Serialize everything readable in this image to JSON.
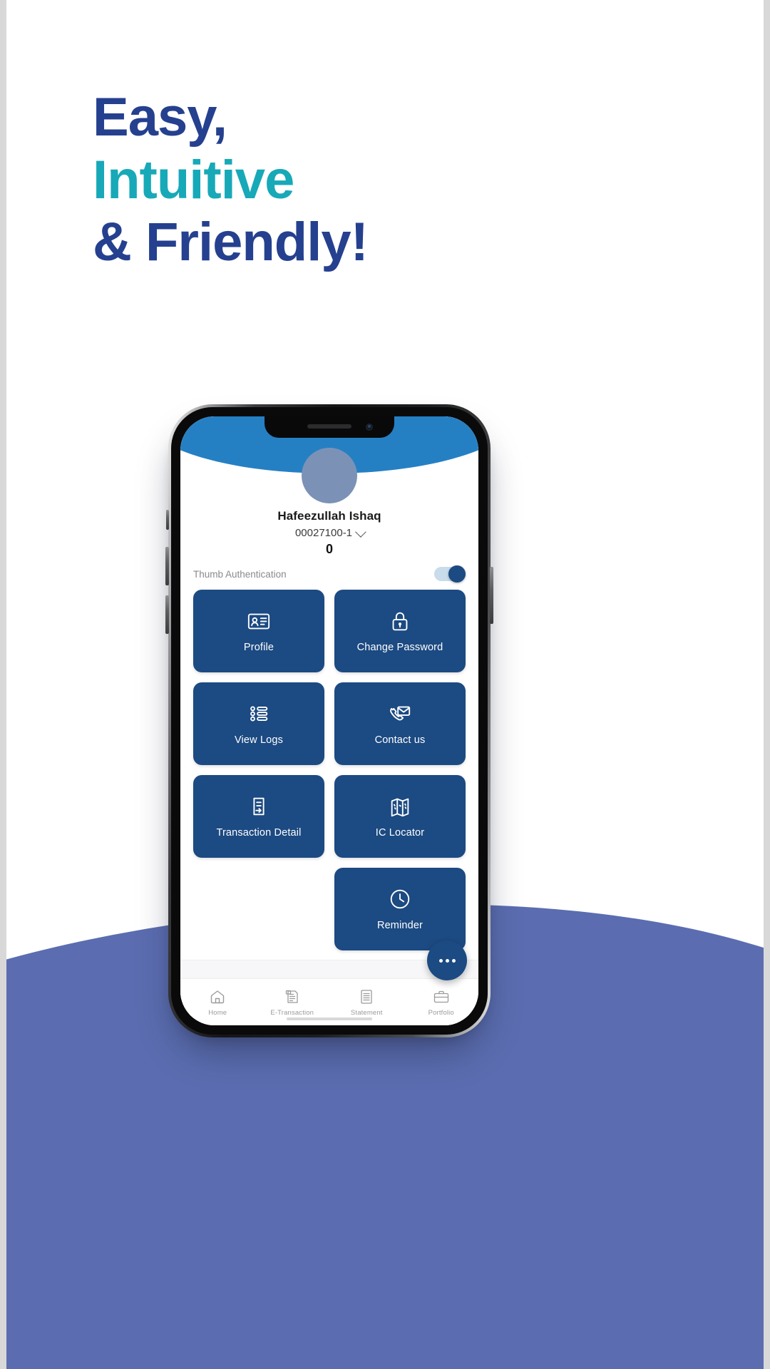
{
  "poster": {
    "headline": {
      "line1": "Easy,",
      "line2": "Intuitive",
      "line3": "& Friendly!"
    },
    "colors": {
      "navy": "#25408F",
      "teal": "#17A9B8",
      "wave": "#5B6DB0",
      "app_header_blue": "#2580C3",
      "tile_blue": "#1C4A82"
    }
  },
  "app": {
    "profile": {
      "avatar": "avatar-placeholder",
      "name": "Hafeezullah Ishaq",
      "account_number": "00027100-1",
      "account_chevron": "chevron-down-icon",
      "balance": "0"
    },
    "thumb_auth": {
      "label": "Thumb Authentication",
      "enabled": true
    },
    "tiles": [
      {
        "id": "profile",
        "label": "Profile",
        "icon": "id-card-icon"
      },
      {
        "id": "change-password",
        "label": "Change Password",
        "icon": "lock-icon"
      },
      {
        "id": "view-logs",
        "label": "View Logs",
        "icon": "list-icon"
      },
      {
        "id": "contact-us",
        "label": "Contact us",
        "icon": "phone-envelope-icon"
      },
      {
        "id": "transaction-detail",
        "label": "Transaction Detail",
        "icon": "document-arrow-icon"
      },
      {
        "id": "ic-locator",
        "label": "IC Locator",
        "icon": "map-icon"
      },
      {
        "id": "reminder",
        "label": "Reminder",
        "icon": "clock-icon"
      }
    ],
    "fab": {
      "icon": "ellipsis-icon",
      "label": "..."
    },
    "tabs": [
      {
        "id": "home",
        "label": "Home",
        "icon": "home-icon",
        "active": true
      },
      {
        "id": "e-transaction",
        "label": "E-Transaction",
        "icon": "etransaction-icon",
        "active": false
      },
      {
        "id": "statement",
        "label": "Statement",
        "icon": "statement-icon",
        "active": false
      },
      {
        "id": "portfolio",
        "label": "Portfolio",
        "icon": "briefcase-icon",
        "active": false
      }
    ]
  }
}
